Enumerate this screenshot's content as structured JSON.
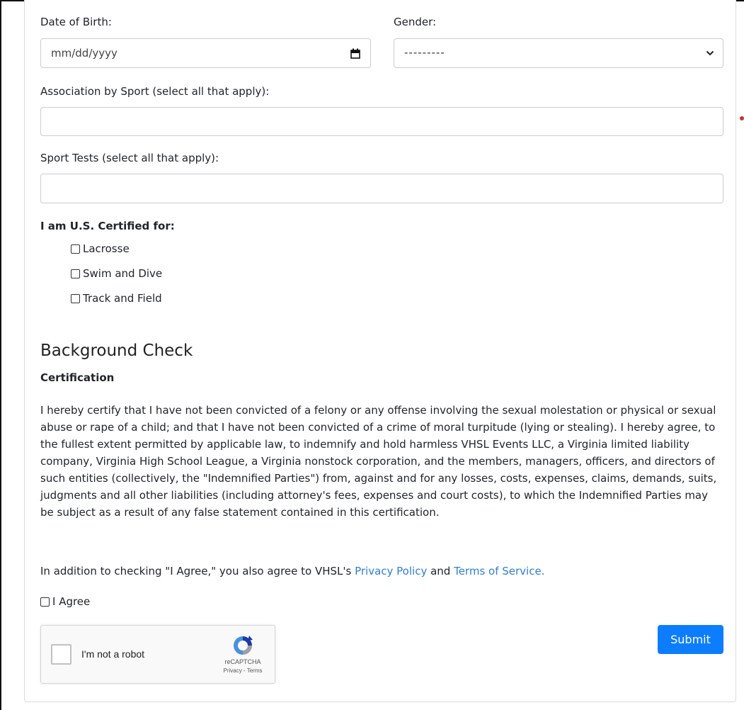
{
  "form": {
    "dob_label": "Date of Birth:",
    "dob_placeholder": "mm/dd/yyyy",
    "gender_label": "Gender:",
    "gender_value": "---------",
    "association_label": "Association by Sport (select all that apply):",
    "association_value": "",
    "sport_tests_label": "Sport Tests (select all that apply):",
    "sport_tests_value": ""
  },
  "certified": {
    "label": "I am U.S. Certified for:",
    "options": [
      {
        "label": "Lacrosse",
        "checked": false
      },
      {
        "label": "Swim and Dive",
        "checked": false
      },
      {
        "label": "Track and Field",
        "checked": false
      }
    ]
  },
  "background": {
    "heading": "Background Check",
    "subheading": "Certification",
    "paragraph": "I hereby certify that I have not been convicted of a felony or any offense involving the sexual molestation or physical or sexual abuse or rape of a child; and that I have not been convicted of a crime of moral turpitude (lying or stealing). I hereby agree, to the fullest extent permitted by applicable law, to indemnify and hold harmless VHSL Events LLC, a Virginia limited liability company, Virginia High School League, a Virginia nonstock corporation, and the members, managers, officers, and directors of such entities (collectively, the \"Indemnified Parties\") from, against and for any losses, costs, expenses, claims, demands, suits, judgments and all other liabilities (including attorney's fees, expenses and court costs), to which the Indemnified Parties may be subject as a result of any false statement contained in this certification.",
    "agree_prefix": "In addition to checking \"I Agree,\" you also agree to VHSL's ",
    "privacy_link": "Privacy Policy",
    "and_text": " and ",
    "terms_link": "Terms of Service.",
    "agree_checkbox_label": "I Agree"
  },
  "recaptcha": {
    "label": "I'm not a robot",
    "brand": "reCAPTCHA",
    "links": "Privacy - Terms"
  },
  "submit_label": "Submit",
  "colors": {
    "accent": "#0d7dff",
    "link": "#2f7fd6"
  }
}
